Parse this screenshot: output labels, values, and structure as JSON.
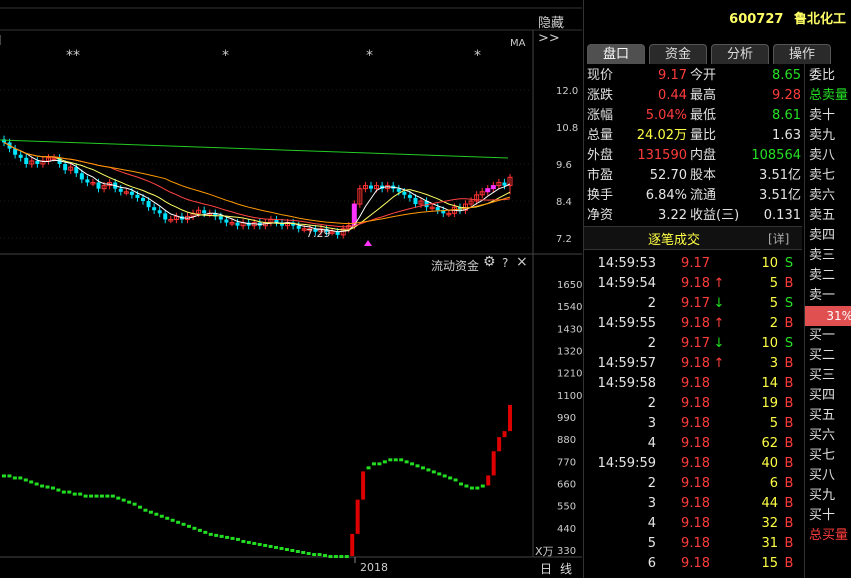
{
  "chart": {
    "hide_button": "隐藏",
    "ma_label": "MA",
    "star_marks": [
      "**",
      "*",
      "*",
      "*"
    ],
    "price_axis": [
      "12.0",
      "10.8",
      "9.6",
      "8.4",
      "7.2"
    ],
    "low_annotation": "7.29",
    "flow_title": "流动资金",
    "flow_axis": [
      "1650",
      "1540",
      "1430",
      "1320",
      "1210",
      "1100",
      "990",
      "880",
      "770",
      "660",
      "550",
      "440",
      "330"
    ],
    "flow_unit": "X万",
    "year_label": "2018",
    "period_day": "日",
    "period_line": "线",
    "help_icon_text": "?",
    "close_icon_text": "×",
    "colors": {
      "up": "#ff3333",
      "down": "#00e5ff",
      "ma_green": "#22cc22",
      "ma_yellow": "#ffff66",
      "ma_white": "#ffffff",
      "ma_red": "#ff4444",
      "ma_orange": "#ff9900",
      "flow_green": "#22dd22",
      "flow_red": "#dd0000"
    }
  },
  "chart_data": {
    "type": "line",
    "title": "流动资金",
    "xlabel": "2018",
    "ylabel": "X万",
    "ylim": [
      280,
      1700
    ],
    "price_ylim": [
      7.0,
      12.2
    ],
    "flow_values": [
      700,
      700,
      690,
      690,
      680,
      670,
      660,
      650,
      645,
      640,
      630,
      620,
      620,
      610,
      610,
      600,
      600,
      600,
      600,
      600,
      600,
      590,
      580,
      570,
      560,
      545,
      530,
      520,
      510,
      500,
      490,
      480,
      470,
      460,
      450,
      440,
      430,
      420,
      410,
      405,
      400,
      395,
      390,
      385,
      375,
      370,
      365,
      360,
      355,
      350,
      345,
      340,
      335,
      330,
      325,
      320,
      315,
      310,
      310,
      305,
      300,
      300,
      300,
      300,
      410,
      580,
      720,
      740,
      760,
      760,
      770,
      780,
      780,
      780,
      770,
      760,
      750,
      740,
      730,
      720,
      710,
      700,
      690,
      680,
      660,
      650,
      640,
      640,
      650,
      700,
      820,
      890,
      920,
      1050
    ],
    "price_closes": [
      10.3,
      10.1,
      9.9,
      9.8,
      9.6,
      9.7,
      9.6,
      9.7,
      9.8,
      9.8,
      9.6,
      9.4,
      9.5,
      9.3,
      9.1,
      9.0,
      9.0,
      8.8,
      8.9,
      9.0,
      8.8,
      8.7,
      8.7,
      8.6,
      8.5,
      8.4,
      8.2,
      8.1,
      8.0,
      7.8,
      7.8,
      7.9,
      7.8,
      7.9,
      8.0,
      8.1,
      8.0,
      8.0,
      7.9,
      7.8,
      7.7,
      7.7,
      7.6,
      7.7,
      7.6,
      7.7,
      7.6,
      7.7,
      7.8,
      7.7,
      7.6,
      7.7,
      7.6,
      7.5,
      7.5,
      7.5,
      7.4,
      7.5,
      7.4,
      7.4,
      7.3,
      7.5,
      7.6,
      8.3,
      8.8,
      8.9,
      8.8,
      8.9,
      8.8,
      8.9,
      8.8,
      8.7,
      8.6,
      8.5,
      8.3,
      8.4,
      8.2,
      8.2,
      8.1,
      8.0,
      8.0,
      8.2,
      8.1,
      8.3,
      8.4,
      8.6,
      8.7,
      8.8,
      8.9,
      9.0,
      8.9,
      9.17
    ]
  },
  "header": {
    "code": "600727",
    "name": "鲁北化工"
  },
  "tabs": [
    "盘口",
    "资金",
    "分析",
    "操作"
  ],
  "quote": [
    {
      "l1": "现价",
      "v1": "9.17",
      "c1": "red",
      "l2": "今开",
      "v2": "8.65",
      "c2": "green"
    },
    {
      "l1": "涨跌",
      "v1": "0.44",
      "c1": "red",
      "l2": "最高",
      "v2": "9.28",
      "c2": "red"
    },
    {
      "l1": "涨幅",
      "v1": "5.04%",
      "c1": "red",
      "l2": "最低",
      "v2": "8.61",
      "c2": "green"
    },
    {
      "l1": "总量",
      "v1": "24.02万",
      "c1": "yellow",
      "l2": "量比",
      "v2": "1.63",
      "c2": "white"
    },
    {
      "l1": "外盘",
      "v1": "131590",
      "c1": "red",
      "l2": "内盘",
      "v2": "108564",
      "c2": "green"
    },
    {
      "l1": "市盈",
      "v1": "52.70",
      "c1": "white",
      "l2": "股本",
      "v2": "3.51亿",
      "c2": "white"
    },
    {
      "l1": "换手",
      "v1": "6.84%",
      "c1": "white",
      "l2": "流通",
      "v2": "3.51亿",
      "c2": "white"
    },
    {
      "l1": "净资",
      "v1": "3.22",
      "c1": "white",
      "l2": "收益(三)",
      "v2": "0.131",
      "c2": "white"
    }
  ],
  "ticks_title": "逐笔成交",
  "ticks_detail": "[详]",
  "ticks": [
    {
      "time": "14:59:53",
      "price": "9.17",
      "arrow": "",
      "vol": "10",
      "side": "S"
    },
    {
      "time": "14:59:54",
      "price": "9.18",
      "arrow": "↑",
      "vol": "5",
      "side": "B"
    },
    {
      "time": "2",
      "price": "9.17",
      "arrow": "↓",
      "vol": "5",
      "side": "S"
    },
    {
      "time": "14:59:55",
      "price": "9.18",
      "arrow": "↑",
      "vol": "2",
      "side": "B"
    },
    {
      "time": "2",
      "price": "9.17",
      "arrow": "↓",
      "vol": "10",
      "side": "S"
    },
    {
      "time": "14:59:57",
      "price": "9.18",
      "arrow": "↑",
      "vol": "3",
      "side": "B"
    },
    {
      "time": "14:59:58",
      "price": "9.18",
      "arrow": "",
      "vol": "14",
      "side": "B"
    },
    {
      "time": "2",
      "price": "9.18",
      "arrow": "",
      "vol": "19",
      "side": "B"
    },
    {
      "time": "3",
      "price": "9.18",
      "arrow": "",
      "vol": "5",
      "side": "B"
    },
    {
      "time": "4",
      "price": "9.18",
      "arrow": "",
      "vol": "62",
      "side": "B"
    },
    {
      "time": "14:59:59",
      "price": "9.18",
      "arrow": "",
      "vol": "40",
      "side": "B"
    },
    {
      "time": "2",
      "price": "9.18",
      "arrow": "",
      "vol": "6",
      "side": "B"
    },
    {
      "time": "3",
      "price": "9.18",
      "arrow": "",
      "vol": "44",
      "side": "B"
    },
    {
      "time": "4",
      "price": "9.18",
      "arrow": "",
      "vol": "32",
      "side": "B"
    },
    {
      "time": "5",
      "price": "9.18",
      "arrow": "",
      "vol": "31",
      "side": "B"
    },
    {
      "time": "6",
      "price": "9.18",
      "arrow": "",
      "vol": "15",
      "side": "B"
    }
  ],
  "orderbook": [
    "委比",
    "总卖量",
    "卖十",
    "卖九",
    "卖八",
    "卖七",
    "卖六",
    "卖五",
    "卖四",
    "卖三",
    "卖二",
    "卖一",
    "31%",
    "买一",
    "买二",
    "买三",
    "买四",
    "买五",
    "买六",
    "买七",
    "买八",
    "买九",
    "买十",
    "总买量"
  ]
}
